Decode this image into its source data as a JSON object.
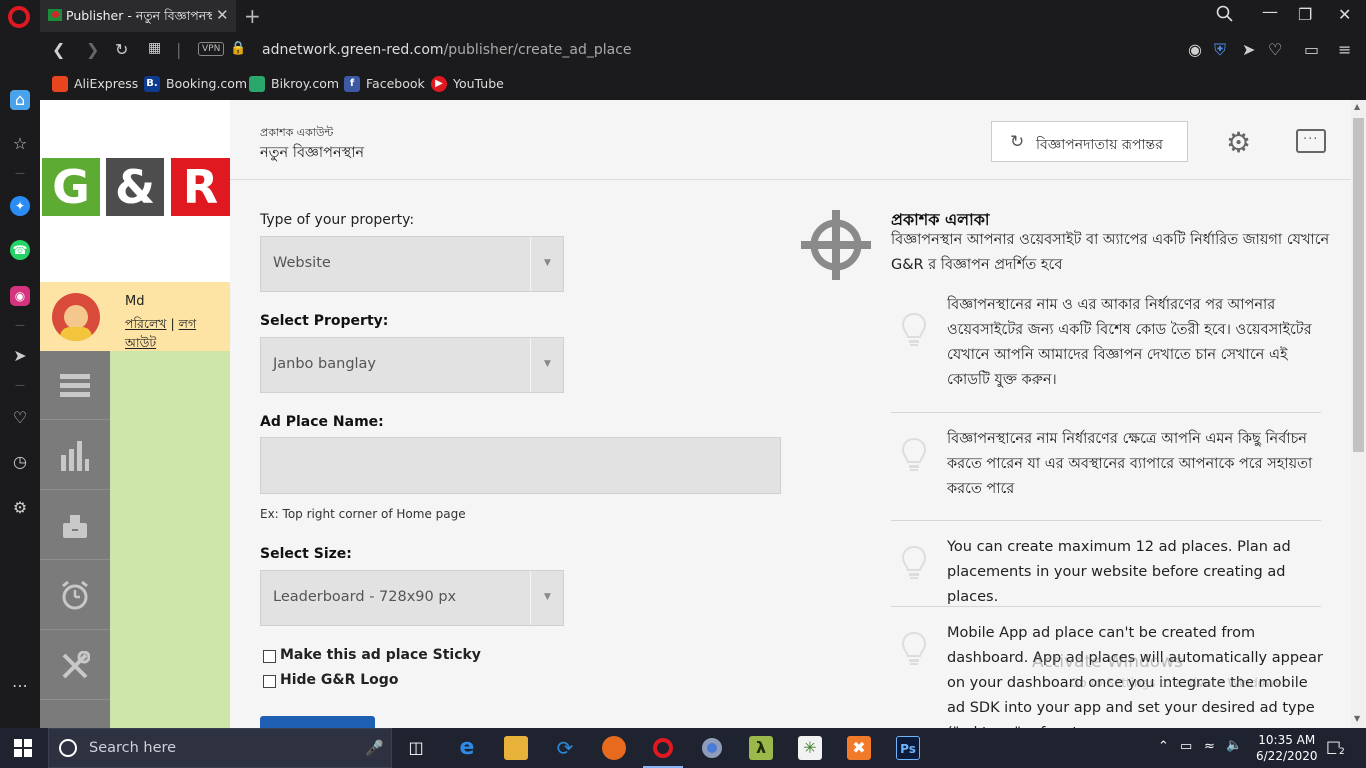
{
  "browser": {
    "tab_title": "Publisher - নতুন বিজ্ঞাপনস্থ",
    "tab_close": "✕",
    "new_tab": "+",
    "url_host": "adnetwork.green-red.com",
    "url_path": "/publisher/create_ad_place",
    "vpn_label": "VPN",
    "bookmarks": [
      "AliExpress",
      "Booking.com",
      "Bikroy.com",
      "Facebook",
      "YouTube"
    ]
  },
  "sidebar": {
    "logo_letters": [
      "G",
      "&",
      "R"
    ],
    "logo_colors": [
      "#5dab32",
      "#4d4d4d",
      "#e0181f"
    ],
    "user_name": "Md",
    "profile_link": "পরিলেখ",
    "divider": "|",
    "logout_link": "লগ আউট",
    "nav_icons": [
      "menu-icon",
      "chart-icon",
      "wallet-icon",
      "alarm-icon",
      "tools-icon"
    ]
  },
  "header": {
    "crumb_small": "প্রকাশক একাউন্ট",
    "crumb_title": "নতুন বিজ্ঞাপনস্থান",
    "switch_label": "বিজ্ঞাপনদাতায় রূপান্তর"
  },
  "form": {
    "property_type_label": "Type of your property:",
    "property_type_value": "Website",
    "select_property_label": "Select Property:",
    "select_property_value": "Janbo banglay",
    "ad_place_name_label": "Ad Place Name:",
    "ad_place_name_value": "",
    "ad_place_hint": "Ex: Top right corner of Home page",
    "select_size_label": "Select Size:",
    "select_size_value": "Leaderboard - 728x90 px",
    "sticky_label": "Make this ad place Sticky",
    "hide_logo_label": "Hide G&R Logo"
  },
  "info": {
    "title": "প্রকাশক এলাকা",
    "subtitle": "বিজ্ঞাপনস্থান আপনার ওয়েবসাইট বা অ্যাপের একটি নির্ধারিত জায়গা যেখানে G&R র বিজ্ঞাপন প্রদর্শিত হবে",
    "tips": [
      "বিজ্ঞাপনস্থানের নাম ও এর আকার নির্ধারণের পর আপনার ওয়েবসাইটের জন্য একটি বিশেষ কোড তৈরী হবে। ওয়েবসাইটের যেখানে আপনি আমাদের বিজ্ঞাপন দেখাতে চান সেখানে এই কোডটি যুক্ত করুন।",
      "বিজ্ঞাপনস্থানের নাম নির্ধারণের ক্ষেত্রে আপনি এমন কিছু নির্বাচন করতে পারেন যা এর অবস্থানের ব্যাপারে আপনাকে পরে সহায়তা করতে পারে",
      "You can create maximum 12 ad places. Plan ad placements in your website before creating ad places.",
      "Mobile App ad place can't be created from dashboard. App ad places will automatically appear on your dashboard once you integrate the mobile ad SDK into your app and set your desired ad type (\"ad type\" refers to"
    ]
  },
  "watermark": {
    "line1": "Activate Windows",
    "line2": "Go to Settings to activate Windows."
  },
  "taskbar": {
    "search_placeholder": "Search here",
    "time": "10:35 AM",
    "date": "6/22/2020",
    "notifications": "2"
  }
}
